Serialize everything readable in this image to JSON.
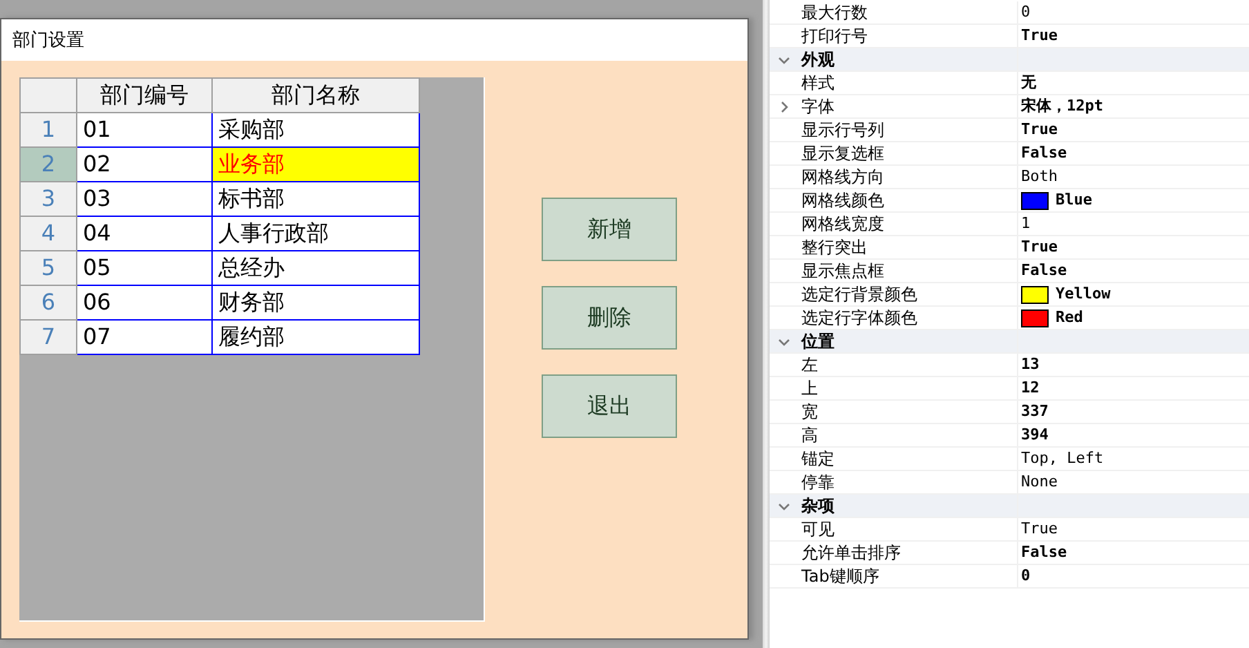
{
  "form": {
    "title": "部门设置",
    "grid": {
      "columns": [
        "部门编号",
        "部门名称"
      ],
      "rows": [
        {
          "number": "1",
          "code": "01",
          "name": "采购部",
          "selected": false
        },
        {
          "number": "2",
          "code": "02",
          "name": "业务部",
          "selected": true
        },
        {
          "number": "3",
          "code": "03",
          "name": "标书部",
          "selected": false
        },
        {
          "number": "4",
          "code": "04",
          "name": "人事行政部",
          "selected": false
        },
        {
          "number": "5",
          "code": "05",
          "name": "总经办",
          "selected": false
        },
        {
          "number": "6",
          "code": "06",
          "name": "财务部",
          "selected": false
        },
        {
          "number": "7",
          "code": "07",
          "name": "履约部",
          "selected": false
        }
      ]
    },
    "buttons": [
      "新增",
      "删除",
      "退出"
    ]
  },
  "property_groups": [
    {
      "items": [
        {
          "name": "最大行数",
          "value": "0",
          "modified": false
        },
        {
          "name": "打印行号",
          "value": "True",
          "modified": true
        }
      ]
    },
    {
      "title": "外观",
      "expanded": true,
      "items": [
        {
          "name": "样式",
          "value": "无",
          "modified": true
        },
        {
          "name": "字体",
          "value": "宋体，12pt",
          "modified": true,
          "expandable": true
        },
        {
          "name": "显示行号列",
          "value": "True",
          "modified": true
        },
        {
          "name": "显示复选框",
          "value": "False",
          "modified": true
        },
        {
          "name": "网格线方向",
          "value": "Both",
          "modified": false
        },
        {
          "name": "网格线颜色",
          "value": "Blue",
          "modified": true,
          "color": "#0000ff"
        },
        {
          "name": "网格线宽度",
          "value": "1",
          "modified": false
        },
        {
          "name": "整行突出",
          "value": "True",
          "modified": true
        },
        {
          "name": "显示焦点框",
          "value": "False",
          "modified": true
        },
        {
          "name": "选定行背景颜色",
          "value": "Yellow",
          "modified": true,
          "color": "#ffff00"
        },
        {
          "name": "选定行字体颜色",
          "value": "Red",
          "modified": true,
          "color": "#ff0000"
        }
      ]
    },
    {
      "title": "位置",
      "expanded": true,
      "items": [
        {
          "name": "左",
          "value": "13",
          "modified": true
        },
        {
          "name": "上",
          "value": "12",
          "modified": true
        },
        {
          "name": "宽",
          "value": "337",
          "modified": true
        },
        {
          "name": "高",
          "value": "394",
          "modified": true
        },
        {
          "name": "锚定",
          "value": "Top, Left",
          "modified": false
        },
        {
          "name": "停靠",
          "value": "None",
          "modified": false
        }
      ]
    },
    {
      "title": "杂项",
      "expanded": true,
      "items": [
        {
          "name": "可见",
          "value": "True",
          "modified": false
        },
        {
          "name": "允许单击排序",
          "value": "False",
          "modified": true
        },
        {
          "name": "Tab键顺序",
          "value": "0",
          "modified": true
        }
      ]
    }
  ]
}
